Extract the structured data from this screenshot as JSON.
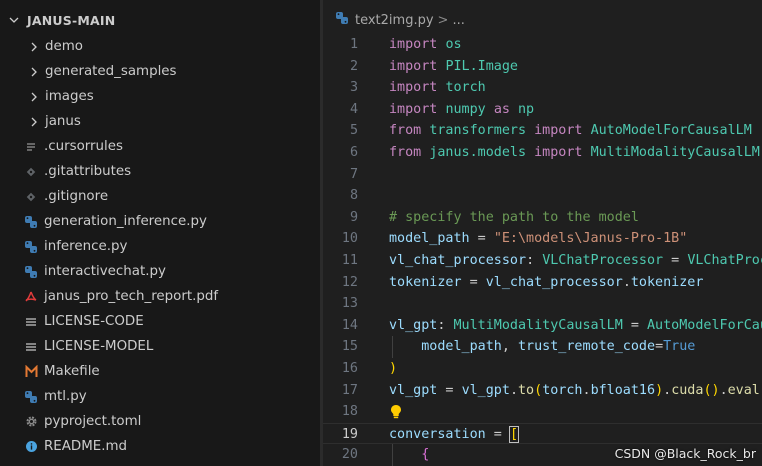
{
  "explorer": {
    "root_label": "JANUS-MAIN",
    "items": [
      {
        "type": "folder",
        "label": "demo",
        "icon": "chevron-right-icon"
      },
      {
        "type": "folder",
        "label": "generated_samples",
        "icon": "chevron-right-icon"
      },
      {
        "type": "folder",
        "label": "images",
        "icon": "chevron-right-icon"
      },
      {
        "type": "folder",
        "label": "janus",
        "icon": "chevron-right-icon"
      },
      {
        "type": "file",
        "label": ".cursorrules",
        "icon": "lines-file-icon"
      },
      {
        "type": "file",
        "label": ".gitattributes",
        "icon": "git-diamond-icon"
      },
      {
        "type": "file",
        "label": ".gitignore",
        "icon": "git-diamond-icon"
      },
      {
        "type": "file",
        "label": "generation_inference.py",
        "icon": "python-icon"
      },
      {
        "type": "file",
        "label": "inference.py",
        "icon": "python-icon"
      },
      {
        "type": "file",
        "label": "interactivechat.py",
        "icon": "python-icon"
      },
      {
        "type": "file",
        "label": "janus_pro_tech_report.pdf",
        "icon": "pdf-icon"
      },
      {
        "type": "file",
        "label": "LICENSE-CODE",
        "icon": "license-lines-icon"
      },
      {
        "type": "file",
        "label": "LICENSE-MODEL",
        "icon": "license-lines-icon"
      },
      {
        "type": "file",
        "label": "Makefile",
        "icon": "makefile-m-icon"
      },
      {
        "type": "file",
        "label": "mtl.py",
        "icon": "python-icon"
      },
      {
        "type": "file",
        "label": "pyproject.toml",
        "icon": "gear-icon"
      },
      {
        "type": "file",
        "label": "README.md",
        "icon": "info-icon"
      }
    ]
  },
  "breadcrumb": {
    "file": "text2img.py",
    "sep": ">",
    "ellipsis": "..."
  },
  "editor": {
    "current_line": "19",
    "lines": [
      {
        "num": "1",
        "tokens": [
          [
            "k",
            "import"
          ],
          [
            "p",
            " "
          ],
          [
            "n",
            "os"
          ]
        ]
      },
      {
        "num": "2",
        "tokens": [
          [
            "k",
            "import"
          ],
          [
            "p",
            " "
          ],
          [
            "n",
            "PIL.Image"
          ]
        ]
      },
      {
        "num": "3",
        "tokens": [
          [
            "k",
            "import"
          ],
          [
            "p",
            " "
          ],
          [
            "n",
            "torch"
          ]
        ]
      },
      {
        "num": "4",
        "tokens": [
          [
            "k",
            "import"
          ],
          [
            "p",
            " "
          ],
          [
            "n",
            "numpy"
          ],
          [
            "p",
            " "
          ],
          [
            "k",
            "as"
          ],
          [
            "p",
            " "
          ],
          [
            "n",
            "np"
          ]
        ]
      },
      {
        "num": "5",
        "tokens": [
          [
            "k",
            "from"
          ],
          [
            "p",
            " "
          ],
          [
            "n",
            "transformers"
          ],
          [
            "p",
            " "
          ],
          [
            "k",
            "import"
          ],
          [
            "p",
            " "
          ],
          [
            "n",
            "AutoModelForCausalLM"
          ]
        ]
      },
      {
        "num": "6",
        "tokens": [
          [
            "k",
            "from"
          ],
          [
            "p",
            " "
          ],
          [
            "n",
            "janus.models"
          ],
          [
            "p",
            " "
          ],
          [
            "k",
            "import"
          ],
          [
            "p",
            " "
          ],
          [
            "n",
            "MultiModalityCausalLM"
          ]
        ]
      },
      {
        "num": "7",
        "tokens": []
      },
      {
        "num": "8",
        "tokens": []
      },
      {
        "num": "9",
        "tokens": [
          [
            "c",
            "# specify the path to the model"
          ]
        ]
      },
      {
        "num": "10",
        "tokens": [
          [
            "v",
            "model_path"
          ],
          [
            "p",
            " = "
          ],
          [
            "s",
            "\"E:\\models\\Janus-Pro-1B\""
          ]
        ]
      },
      {
        "num": "11",
        "tokens": [
          [
            "v",
            "vl_chat_processor"
          ],
          [
            "p",
            ": "
          ],
          [
            "n",
            "VLChatProcessor"
          ],
          [
            "p",
            " = "
          ],
          [
            "n",
            "VLChatProcessor"
          ]
        ]
      },
      {
        "num": "12",
        "tokens": [
          [
            "v",
            "tokenizer"
          ],
          [
            "p",
            " = "
          ],
          [
            "v",
            "vl_chat_processor"
          ],
          [
            "p",
            "."
          ],
          [
            "v",
            "tokenizer"
          ]
        ]
      },
      {
        "num": "13",
        "tokens": []
      },
      {
        "num": "14",
        "tokens": [
          [
            "v",
            "vl_gpt"
          ],
          [
            "p",
            ": "
          ],
          [
            "n",
            "MultiModalityCausalLM"
          ],
          [
            "p",
            " = "
          ],
          [
            "n",
            "AutoModelForCausalLM"
          ]
        ]
      },
      {
        "num": "15",
        "tokens": [
          [
            "p",
            "    "
          ],
          [
            "v",
            "model_path"
          ],
          [
            "p",
            ", "
          ],
          [
            "v",
            "trust_remote_code"
          ],
          [
            "p",
            "="
          ],
          [
            "b",
            "True"
          ]
        ]
      },
      {
        "num": "16",
        "tokens": [
          [
            "y",
            ")"
          ]
        ]
      },
      {
        "num": "17",
        "tokens": [
          [
            "v",
            "vl_gpt"
          ],
          [
            "p",
            " = "
          ],
          [
            "v",
            "vl_gpt"
          ],
          [
            "p",
            "."
          ],
          [
            "f",
            "to"
          ],
          [
            "y",
            "("
          ],
          [
            "v",
            "torch"
          ],
          [
            "p",
            "."
          ],
          [
            "v",
            "bfloat16"
          ],
          [
            "y",
            ")"
          ],
          [
            "p",
            "."
          ],
          [
            "f",
            "cuda"
          ],
          [
            "y",
            "()"
          ],
          [
            "p",
            "."
          ],
          [
            "f",
            "eval"
          ],
          [
            "y",
            "()"
          ]
        ]
      },
      {
        "num": "18",
        "tokens": []
      },
      {
        "num": "19",
        "tokens": [
          [
            "v",
            "conversation"
          ],
          [
            "p",
            " = "
          ],
          [
            "y",
            "["
          ]
        ]
      },
      {
        "num": "20",
        "tokens": [
          [
            "p",
            "    "
          ],
          [
            "pk",
            "{"
          ]
        ]
      }
    ]
  },
  "watermark": "CSDN @Black_Rock_br",
  "colors": {
    "sidebar_bg": "#181818",
    "editor_bg": "#1f1f1f",
    "keyword": "#c586c0",
    "class": "#4ec9b0",
    "variable": "#9cdcfe",
    "string": "#ce9178",
    "comment": "#6a9955",
    "function": "#dcdcaa",
    "constant": "#569cd6"
  }
}
